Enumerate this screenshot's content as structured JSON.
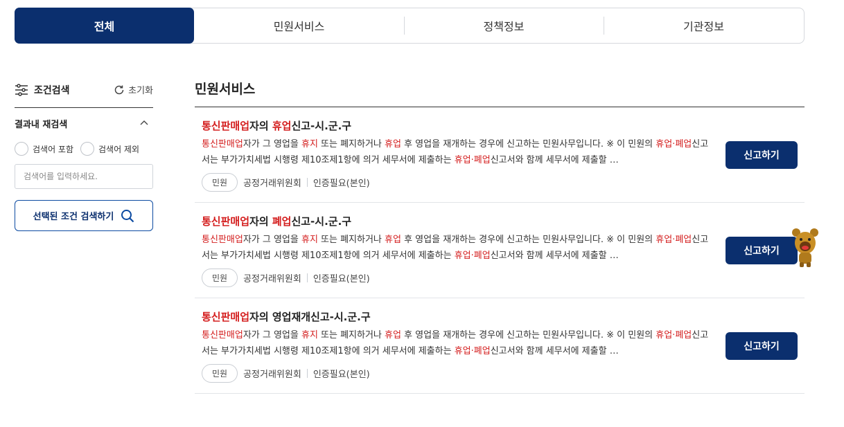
{
  "tabs": [
    {
      "label": "전체",
      "active": true
    },
    {
      "label": "민원서비스",
      "active": false
    },
    {
      "label": "정책정보",
      "active": false
    },
    {
      "label": "기관정보",
      "active": false
    }
  ],
  "sidebar": {
    "title": "조건검색",
    "reset_label": "초기화",
    "section_label": "결과내 재검색",
    "radio_include": "검색어 포함",
    "radio_exclude": "검색어 제외",
    "search_placeholder": "검색어를 입력하세요.",
    "search_button": "선택된 조건 검색하기"
  },
  "main": {
    "section_title": "민원서비스",
    "items": [
      {
        "title_hl1": "통신판매업",
        "title_mid": "자의 ",
        "title_hl2": "휴업",
        "title_rest": "신고-시.군.구",
        "desc": [
          {
            "t": "통신판매업",
            "hl": true
          },
          {
            "t": "자가 그 영업을 ",
            "hl": false
          },
          {
            "t": "휴지",
            "hl": true
          },
          {
            "t": " 또는 폐지하거나 ",
            "hl": false
          },
          {
            "t": "휴업",
            "hl": true
          },
          {
            "t": " 후 영업을 재개하는 경우에 신고하는 민원사무입니다. ※ 이 민원의 ",
            "hl": false
          },
          {
            "t": "휴업·폐업",
            "hl": true
          },
          {
            "t": "신고서는 부가가치세법 시행령 제10조제1항에 의거 세무서에 제출하는 ",
            "hl": false
          },
          {
            "t": "휴업·폐업",
            "hl": true
          },
          {
            "t": "신고서와 함께 세무서에 제출할 …",
            "hl": false
          }
        ],
        "chip": "민원",
        "agency": "공정거래위원회",
        "auth": "인증필요(본인)",
        "button": "신고하기"
      },
      {
        "title_hl1": "통신판매업",
        "title_mid": "자의 ",
        "title_hl2": "폐업",
        "title_rest": "신고-시.군.구",
        "desc": [
          {
            "t": "통신판매업",
            "hl": true
          },
          {
            "t": "자가 그 영업을 ",
            "hl": false
          },
          {
            "t": "휴지",
            "hl": true
          },
          {
            "t": " 또는 폐지하거나 ",
            "hl": false
          },
          {
            "t": "휴업",
            "hl": true
          },
          {
            "t": " 후 영업을 재개하는 경우에 신고하는 민원사무입니다. ※ 이 민원의 ",
            "hl": false
          },
          {
            "t": "휴업·폐업",
            "hl": true
          },
          {
            "t": "신고서는 부가가치세법 시행령 제10조제1항에 의거 세무서에 제출하는 ",
            "hl": false
          },
          {
            "t": "휴업·폐업",
            "hl": true
          },
          {
            "t": "신고서와 함께 세무서에 제출할 …",
            "hl": false
          }
        ],
        "chip": "민원",
        "agency": "공정거래위원회",
        "auth": "인증필요(본인)",
        "button": "신고하기"
      },
      {
        "title_hl1": "통신판매업",
        "title_mid": "자의 영업재개신고-시.군.구",
        "title_hl2": "",
        "title_rest": "",
        "desc": [
          {
            "t": "통신판매업",
            "hl": true
          },
          {
            "t": "자가 그 영업을 ",
            "hl": false
          },
          {
            "t": "휴지",
            "hl": true
          },
          {
            "t": " 또는 폐지하거나 ",
            "hl": false
          },
          {
            "t": "휴업",
            "hl": true
          },
          {
            "t": " 후 영업을 재개하는 경우에 신고하는 민원사무입니다. ※ 이 민원의 ",
            "hl": false
          },
          {
            "t": "휴업·폐업",
            "hl": true
          },
          {
            "t": "신고서는 부가가치세법 시행령 제10조제1항에 의거 세무서에 제출하는 ",
            "hl": false
          },
          {
            "t": "휴업·폐업",
            "hl": true
          },
          {
            "t": "신고서와 함께 세무서에 제출할 …",
            "hl": false
          }
        ],
        "chip": "민원",
        "agency": "공정거래위원회",
        "auth": "인증필요(본인)",
        "button": "신고하기"
      }
    ]
  },
  "colors": {
    "primary": "#0b2f6e",
    "highlight": "#d41e1e"
  },
  "icons": {
    "filter": "sliders-icon",
    "reset": "refresh-icon",
    "collapse": "chevron-up-icon",
    "search": "search-icon",
    "mascot": "bear-mascot-icon"
  }
}
